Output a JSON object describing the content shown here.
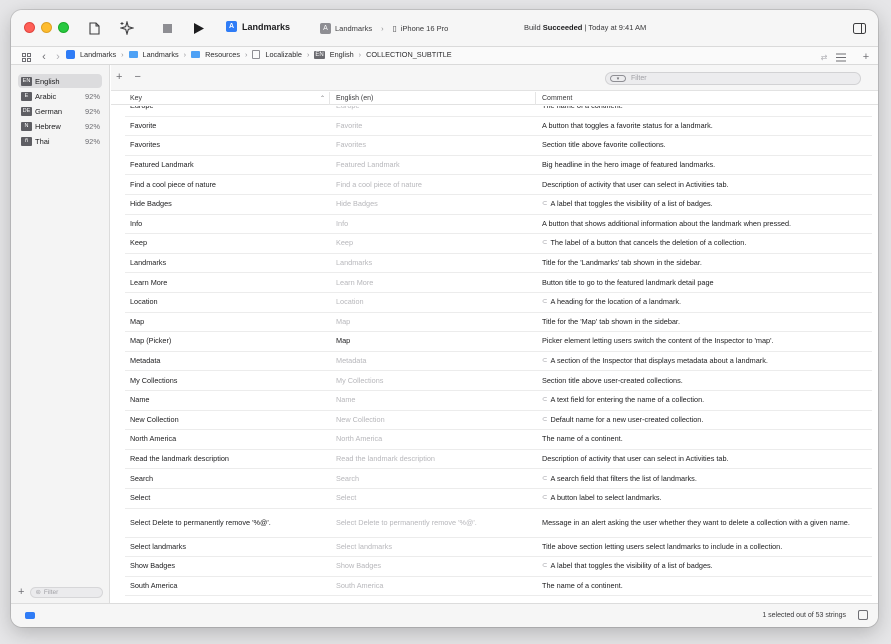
{
  "toolbar": {
    "scheme_title": "Landmarks",
    "scheme_target": "Landmarks",
    "device": "iPhone 16 Pro",
    "status_prefix": "Build ",
    "status_bold": "Succeeded",
    "status_suffix": " | Today at 9:41 AM"
  },
  "breadcrumb": [
    "Landmarks",
    "Landmarks",
    "Resources",
    "Localizable",
    "English",
    "COLLECTION_SUBTITLE"
  ],
  "sidebar": {
    "languages": [
      {
        "code": "EN",
        "name": "English",
        "pct": ""
      },
      {
        "code": "E",
        "name": "Arabic",
        "pct": "92%"
      },
      {
        "code": "DE",
        "name": "German",
        "pct": "92%"
      },
      {
        "code": "N",
        "name": "Hebrew",
        "pct": "92%"
      },
      {
        "code": "ñ",
        "name": "Thai",
        "pct": "92%"
      }
    ],
    "filter_placeholder": "Filter"
  },
  "main": {
    "filter_placeholder": "Filter",
    "columns": {
      "key": "Key",
      "english": "English (en)",
      "comment": "Comment"
    }
  },
  "rows": [
    {
      "key": "Europe",
      "en": "Europe",
      "comment": "The name of a continent.",
      "en_set": false,
      "icon": false
    },
    {
      "key": "Favorite",
      "en": "Favorite",
      "comment": "A button that toggles a favorite status for a landmark.",
      "en_set": false,
      "icon": false
    },
    {
      "key": "Favorites",
      "en": "Favorites",
      "comment": "Section title above favorite collections.",
      "en_set": false,
      "icon": false
    },
    {
      "key": "Featured Landmark",
      "en": "Featured Landmark",
      "comment": "Big headline in the hero image of featured landmarks.",
      "en_set": false,
      "icon": false
    },
    {
      "key": "Find a cool piece of nature",
      "en": "Find a cool piece of nature",
      "comment": "Description of activity that user can select in Activities tab.",
      "en_set": false,
      "icon": false
    },
    {
      "key": "Hide Badges",
      "en": "Hide Badges",
      "comment": "A label that toggles the visibility of a list of badges.",
      "en_set": false,
      "icon": true
    },
    {
      "key": "Info",
      "en": "Info",
      "comment": "A button that shows additional information about the landmark when pressed.",
      "en_set": false,
      "icon": false
    },
    {
      "key": "Keep",
      "en": "Keep",
      "comment": "The label of a button that cancels the deletion of a collection.",
      "en_set": false,
      "icon": true
    },
    {
      "key": "Landmarks",
      "en": "Landmarks",
      "comment": "Title for the 'Landmarks' tab shown in the sidebar.",
      "en_set": false,
      "icon": false
    },
    {
      "key": "Learn More",
      "en": "Learn More",
      "comment": "Button title to go to the featured landmark detail page",
      "en_set": false,
      "icon": false
    },
    {
      "key": "Location",
      "en": "Location",
      "comment": "A heading for the location of a landmark.",
      "en_set": false,
      "icon": true
    },
    {
      "key": "Map",
      "en": "Map",
      "comment": "Title for the 'Map' tab shown in the sidebar.",
      "en_set": false,
      "icon": false
    },
    {
      "key": "Map (Picker)",
      "en": "Map",
      "comment": "Picker element letting users switch the content of the Inspector to 'map'.",
      "en_set": true,
      "icon": false
    },
    {
      "key": "Metadata",
      "en": "Metadata",
      "comment": "A section of the Inspector that displays metadata about a landmark.",
      "en_set": false,
      "icon": true
    },
    {
      "key": "My Collections",
      "en": "My Collections",
      "comment": "Section title above user-created collections.",
      "en_set": false,
      "icon": false
    },
    {
      "key": "Name",
      "en": "Name",
      "comment": "A text field for entering the name of a collection.",
      "en_set": false,
      "icon": true
    },
    {
      "key": "New Collection",
      "en": "New Collection",
      "comment": "Default name for a new user-created collection.",
      "en_set": false,
      "icon": true
    },
    {
      "key": "North America",
      "en": "North America",
      "comment": "The name of a continent.",
      "en_set": false,
      "icon": false
    },
    {
      "key": "Read the landmark description",
      "en": "Read the landmark description",
      "comment": "Description of activity that user can select in Activities tab.",
      "en_set": false,
      "icon": false
    },
    {
      "key": "Search",
      "en": "Search",
      "comment": "A search field that filters the list of landmarks.",
      "en_set": false,
      "icon": true
    },
    {
      "key": "Select",
      "en": "Select",
      "comment": "A button label to select landmarks.",
      "en_set": false,
      "icon": true
    },
    {
      "key": "Select Delete to permanently remove '%@'.",
      "en": "Select Delete to permanently remove '%@'.",
      "comment": "Message in an alert asking the user whether they want to delete a collection with a given name.",
      "en_set": false,
      "icon": false
    },
    {
      "key": "Select landmarks",
      "en": "Select landmarks",
      "comment": "Title above section letting users select landmarks to include in a collection.",
      "en_set": false,
      "icon": false
    },
    {
      "key": "Show Badges",
      "en": "Show Badges",
      "comment": "A label that toggles the visibility of a list of badges.",
      "en_set": false,
      "icon": true
    },
    {
      "key": "South America",
      "en": "South America",
      "comment": "The name of a continent.",
      "en_set": false,
      "icon": false
    }
  ],
  "footer": {
    "status": "1 selected out of 53 strings"
  }
}
